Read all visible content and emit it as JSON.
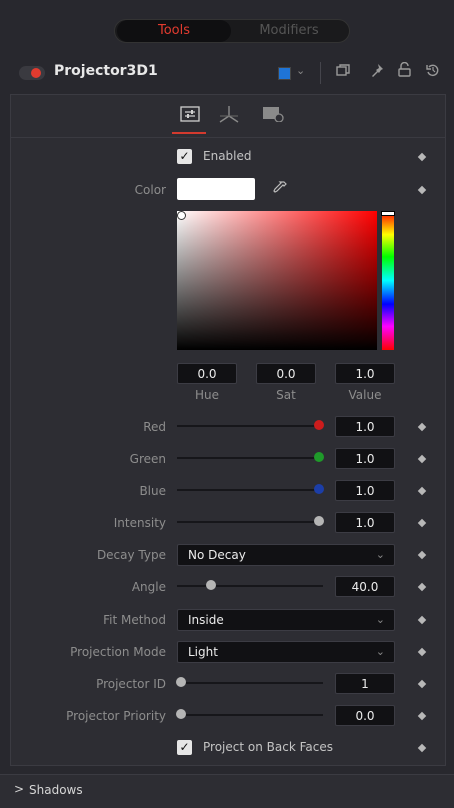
{
  "top_tabs": {
    "tools": "Tools",
    "modifiers": "Modifiers"
  },
  "header": {
    "tool_name": "Projector3D1",
    "color_swatch": "#1f74d6"
  },
  "icons": {
    "header": [
      "chevron-down-icon",
      "copy-icon",
      "pin-icon",
      "lock-icon",
      "reset-icon"
    ],
    "panel_tabs": [
      "controls-tab-icon",
      "transform-3d-tab-icon",
      "settings-tab-icon"
    ]
  },
  "controls": {
    "enabled": {
      "label": "Enabled",
      "checked": true
    },
    "color": {
      "label": "Color",
      "swatch": "#ffffff"
    },
    "hsv": {
      "hue": "0.0",
      "sat": "0.0",
      "value": "1.0",
      "hue_label": "Hue",
      "sat_label": "Sat",
      "value_label": "Value"
    },
    "red": {
      "label": "Red",
      "value": "1.0",
      "level": 1.0,
      "color": "#cc1c1c"
    },
    "green": {
      "label": "Green",
      "value": "1.0",
      "level": 1.0,
      "color": "#1f9a2a"
    },
    "blue": {
      "label": "Blue",
      "value": "1.0",
      "level": 1.0,
      "color": "#1c3ea8"
    },
    "intensity": {
      "label": "Intensity",
      "value": "1.0",
      "level": 1.0
    },
    "decay_type": {
      "label": "Decay Type",
      "value": "No Decay"
    },
    "angle": {
      "label": "Angle",
      "value": "40.0"
    },
    "fit_method": {
      "label": "Fit Method",
      "value": "Inside"
    },
    "projection_mode": {
      "label": "Projection Mode",
      "value": "Light"
    },
    "projector_id": {
      "label": "Projector ID",
      "value": "1"
    },
    "projector_priority": {
      "label": "Projector Priority",
      "value": "0.0"
    },
    "back_faces": {
      "label": "Project on Back Faces",
      "checked": true
    }
  },
  "sections": {
    "shadows": "Shadows"
  },
  "accent": "#e23b2f"
}
